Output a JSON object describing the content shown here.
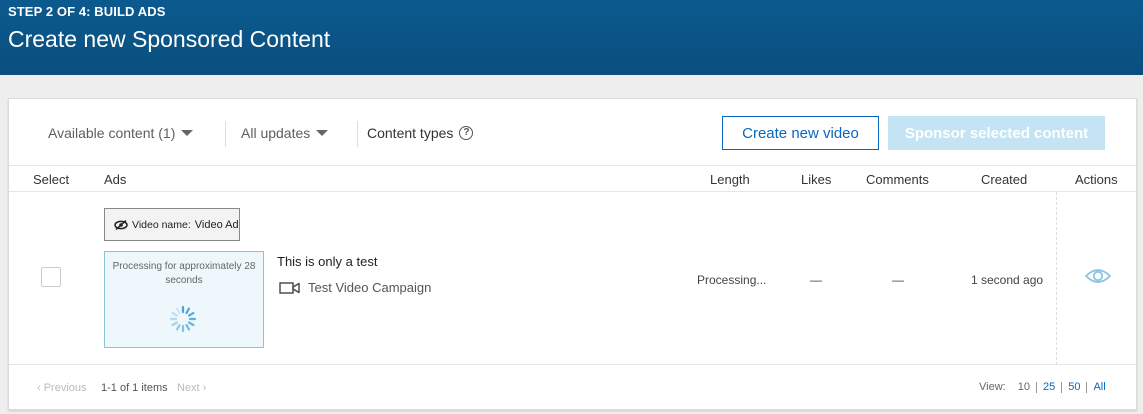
{
  "header": {
    "step": "STEP 2 OF 4: BUILD ADS",
    "title": "Create new Sponsored Content"
  },
  "toolbar": {
    "filter_content": "Available content (1)",
    "filter_updates": "All updates",
    "content_types": "Content types",
    "create_video_label": "Create new video",
    "sponsor_label": "Sponsor selected content"
  },
  "table": {
    "columns": {
      "select": "Select",
      "ads": "Ads",
      "length": "Length",
      "likes": "Likes",
      "comments": "Comments",
      "created": "Created",
      "actions": "Actions"
    },
    "rows": [
      {
        "video_name_label": "Video name:",
        "video_name": "Video Ad",
        "processing_text": "Processing for approximately 28 seconds",
        "ad_text": "This is only a test",
        "campaign": "Test Video Campaign",
        "length": "Processing...",
        "likes": "—",
        "comments": "—",
        "created": "1 second ago"
      }
    ]
  },
  "footer": {
    "previous": "‹ Previous",
    "range": "1-1 of 1 items",
    "next": "Next ›",
    "view_label": "View:",
    "view_options": [
      "10",
      "25",
      "50",
      "All"
    ],
    "current_view": "10"
  },
  "colors": {
    "header_bg": "#0b5a8f",
    "accent": "#0a66c2",
    "disabled_button": "#c4e3f3"
  }
}
